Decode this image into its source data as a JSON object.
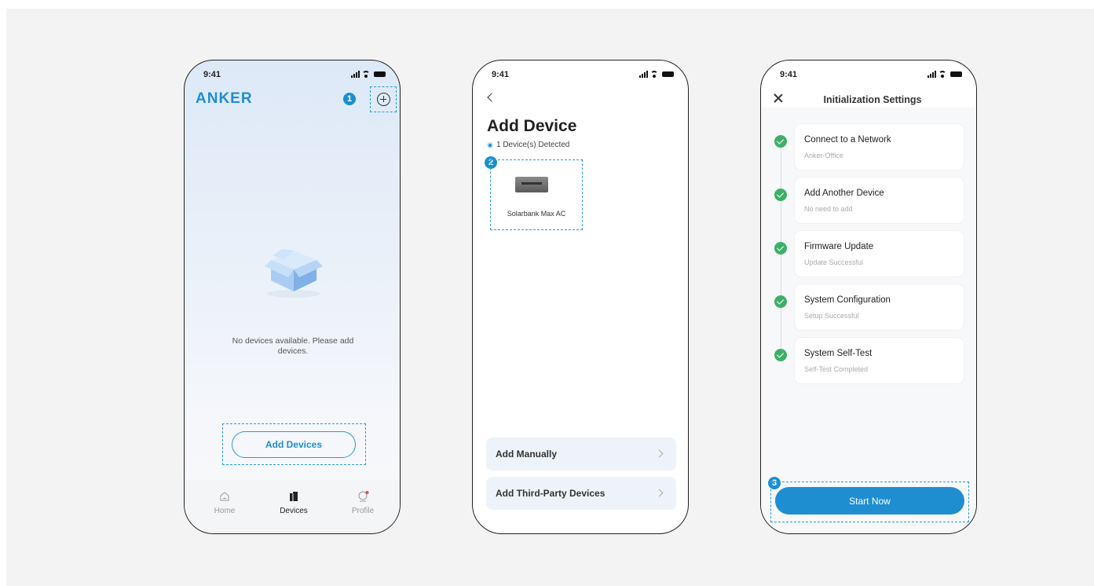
{
  "status_time": "9:41",
  "screen1": {
    "logo": "ANKER",
    "empty_message": "No devices available. Please add devices.",
    "add_devices_button": "Add Devices",
    "tabs": [
      {
        "label": "Home",
        "icon": "home-icon"
      },
      {
        "label": "Devices",
        "icon": "devices-icon",
        "active": true
      },
      {
        "label": "Profile",
        "icon": "profile-icon"
      }
    ],
    "badge": "1"
  },
  "screen2": {
    "title": "Add Device",
    "detected": "1 Device(s) Detected",
    "device_name": "Solarbank Max AC",
    "badge": "2",
    "options": [
      {
        "label": "Add Manually"
      },
      {
        "label": "Add Third-Party Devices"
      }
    ]
  },
  "screen3": {
    "title": "Initialization Settings",
    "badge": "3",
    "steps": [
      {
        "title": "Connect to a Network",
        "subtitle": "Anker-Office"
      },
      {
        "title": "Add Another Device",
        "subtitle": "No need to add"
      },
      {
        "title": "Firmware Update",
        "subtitle": "Update Successful"
      },
      {
        "title": "System Configuration",
        "subtitle": "Setup Successful"
      },
      {
        "title": "System Self-Test",
        "subtitle": "Self-Test Completed"
      }
    ],
    "start_button": "Start Now"
  },
  "colors": {
    "accent": "#1f8ed1",
    "success": "#3db067",
    "annotation": "#2a9ad6"
  }
}
